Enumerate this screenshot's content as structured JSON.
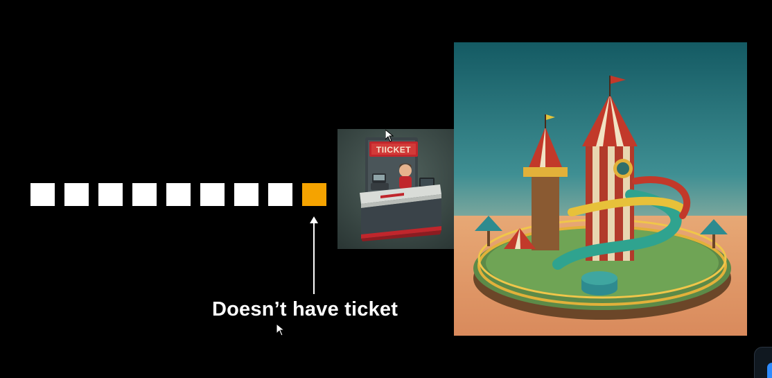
{
  "queue": {
    "slots": 9,
    "current_index": 8,
    "slot_color": "#ffffff",
    "current_color": "#f5a300"
  },
  "caption": "Doesn’t have ticket",
  "booth": {
    "sign_text": "TIICKET"
  },
  "icons": [
    "up-arrow-icon",
    "mouse-cursor-icon"
  ],
  "colors": {
    "background": "#000000",
    "sky_top": "#145a63",
    "sky_bottom": "#e9a77a"
  }
}
